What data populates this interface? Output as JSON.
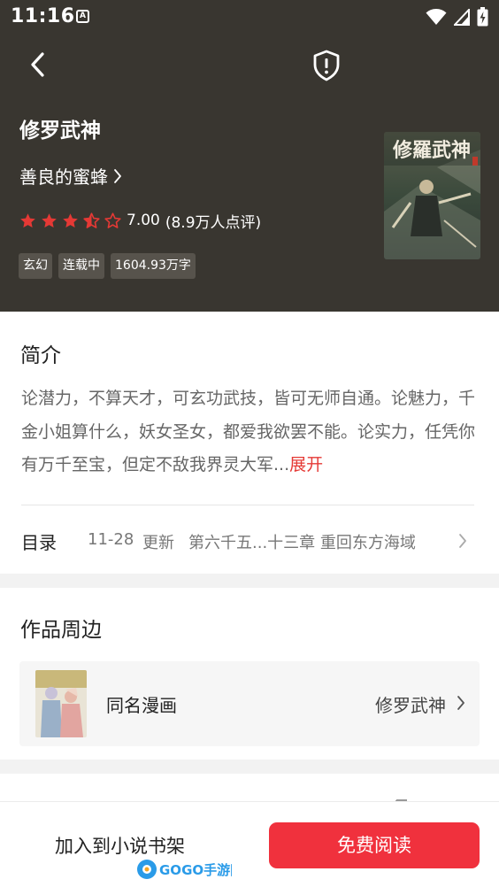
{
  "status_bar": {
    "time": "11:16",
    "notification_badge": "A",
    "icons": [
      "wifi-icon",
      "signal-icon",
      "battery-charging-icon"
    ]
  },
  "nav": {
    "back_icon": "chevron-left-icon",
    "report_icon": "shield-alert-icon"
  },
  "book": {
    "title": "修罗武神",
    "author": "善良的蜜蜂",
    "rating": {
      "stars": 3.5,
      "max_stars": 5,
      "score": "7.00",
      "count_text": "(8.9万人点评)"
    },
    "tags": [
      "玄幻",
      "连载中",
      "1604.93万字"
    ],
    "cover_title_art": "修羅武神"
  },
  "intro": {
    "heading": "简介",
    "text": "论潜力，不算天才，可玄功武技，皆可无师自通。论魅力，千金小姐算什么，妖女圣女，都爱我欲罢不能。论实力，任凭你有万千至宝，但定不敌我界灵大军...",
    "expand_label": "展开"
  },
  "toc": {
    "label": "目录",
    "date": "11-28",
    "update_label": "更新",
    "latest_chapter": "第六千五...十三章 重回东方海域"
  },
  "works": {
    "heading": "作品周边",
    "item_label": "同名漫画",
    "item_value": "修罗武神"
  },
  "next_section": {
    "heading_partial": "书评"
  },
  "bottom": {
    "add_shelf_label": "加入到小说书架",
    "read_label": "免费阅读",
    "watermark_text": "GOGO手游网"
  },
  "colors": {
    "header_bg": "#393630",
    "accent_red": "#f0313d",
    "star_red": "#e53935",
    "expand_red": "#e53935",
    "tag_bg": "#57534c"
  }
}
